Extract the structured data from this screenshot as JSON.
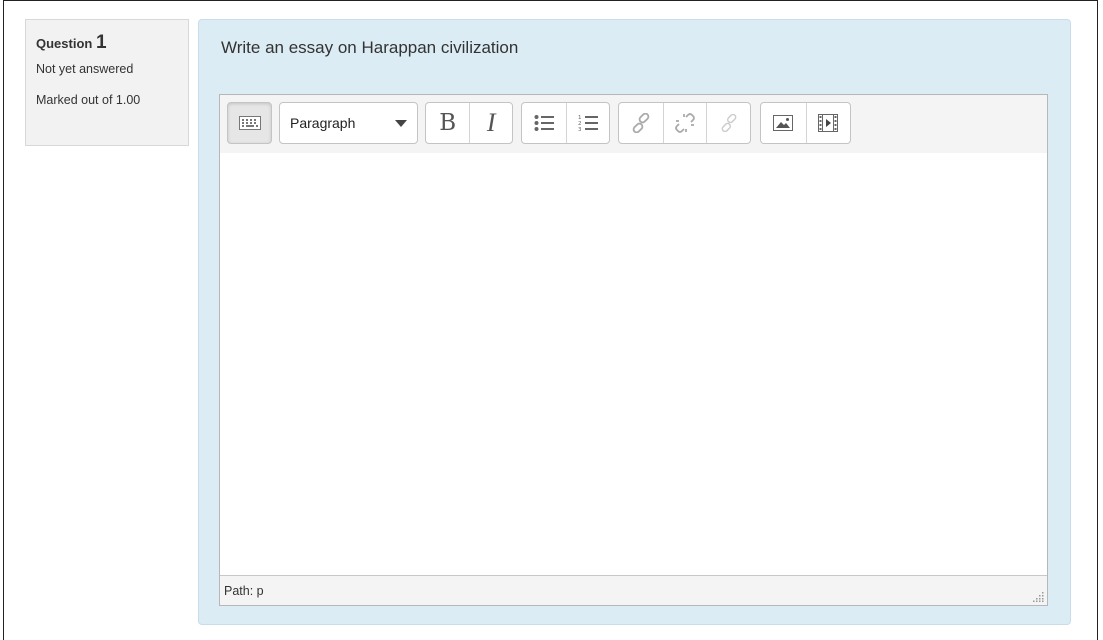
{
  "question": {
    "label": "Question",
    "number": "1",
    "status": "Not yet answered",
    "marks": "Marked out of 1.00",
    "text": "Write an essay on Harappan civilization"
  },
  "editor": {
    "format_select": {
      "value": "Paragraph"
    },
    "toolbar_icons": [
      "toolbar-toggle-icon",
      "bold-icon",
      "italic-icon",
      "bullet-list-icon",
      "numbered-list-icon",
      "link-icon",
      "unlink-icon",
      "anchor-icon",
      "image-icon",
      "media-icon"
    ],
    "bold_label": "B",
    "italic_label": "I",
    "path_label": "Path: p"
  },
  "colors": {
    "formulation_bg": "#dcecf5",
    "info_bg": "#f2f2f2",
    "toolbar_bg": "#f4f4f4"
  }
}
